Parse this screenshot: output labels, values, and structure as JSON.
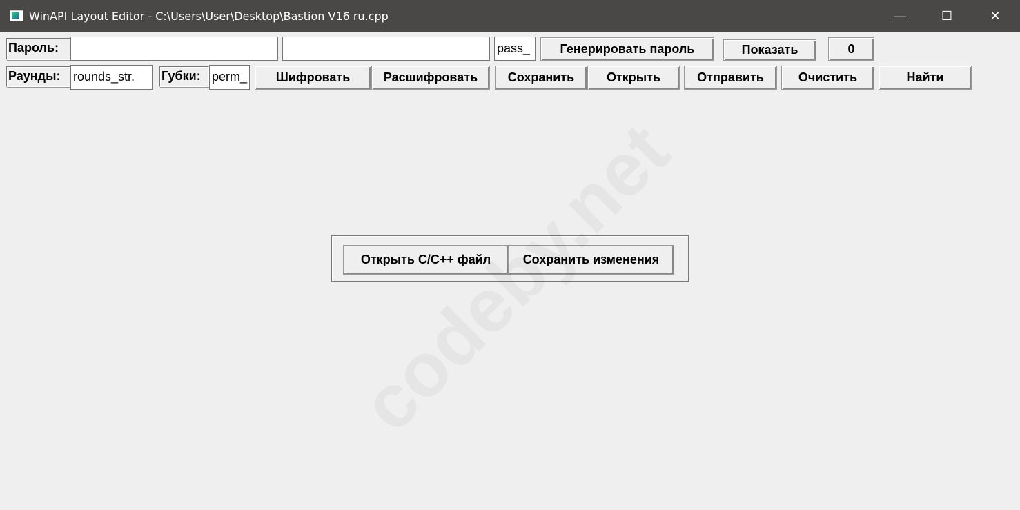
{
  "window": {
    "title": "WinAPI Layout Editor - C:\\Users\\User\\Desktop\\Bastion V16 ru.cpp",
    "minimize": "—",
    "maximize": "☐",
    "close": "✕"
  },
  "row1": {
    "password_label": "Пароль:",
    "password_value": "",
    "password2_value": "",
    "pass_field": "pass_",
    "generate_label": "Генерировать пароль",
    "show_label": "Показать",
    "counter_label": "0"
  },
  "row2": {
    "rounds_label": "Раунды:",
    "rounds_value": "rounds_str.",
    "sponges_label": "Губки:",
    "perm_value": "perm_",
    "encrypt": "Шифровать",
    "decrypt": "Расшифровать",
    "save": "Сохранить",
    "open": "Открыть",
    "send": "Отправить",
    "clear": "Очистить",
    "find": "Найти"
  },
  "panel": {
    "open_file": "Открыть C/C++ файл",
    "save_changes": "Сохранить изменения"
  },
  "watermark": "codeby.net"
}
